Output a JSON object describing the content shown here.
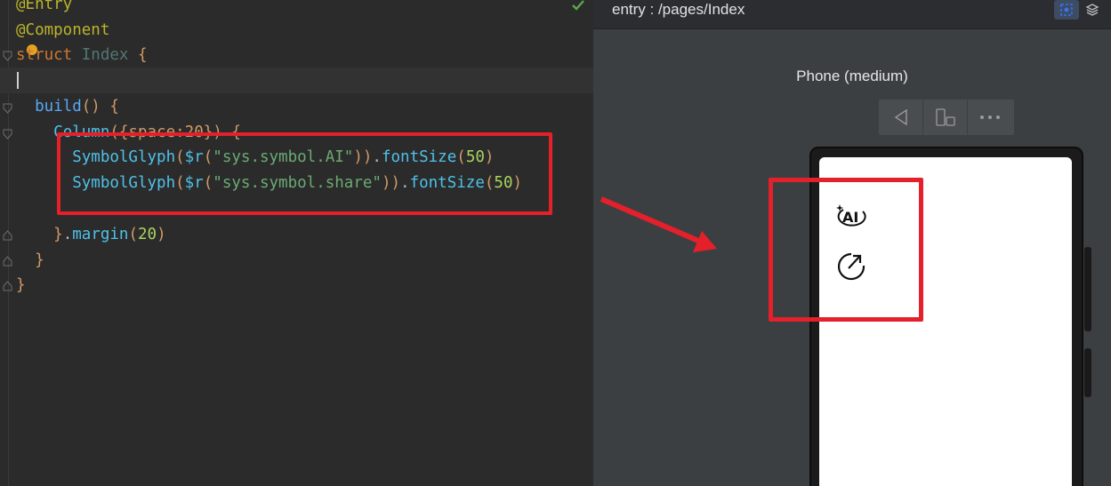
{
  "editor": {
    "lines": {
      "l0": {
        "annotation": "@Entry"
      },
      "l1": {
        "annotation": "@Component"
      },
      "l2": {
        "kw": "struct",
        "name": "Index",
        "brace": "{"
      },
      "l4": {
        "fn": "build",
        "parens": "()",
        "brace": "{"
      },
      "l5": {
        "fn": "Column",
        "args": "({space:20})",
        "brace": "{"
      },
      "l6": {
        "fn": "SymbolGlyph",
        "res": "$r",
        "open": "(",
        "str": "\"sys.symbol.AI\"",
        "close": "))",
        "dot": ".",
        "method": "fontSize",
        "popen": "(",
        "num": "50",
        "pclose": ")"
      },
      "l7": {
        "fn": "SymbolGlyph",
        "res": "$r",
        "open": "(",
        "str": "\"sys.symbol.share\"",
        "close": "))",
        "dot": ".",
        "method": "fontSize",
        "popen": "(",
        "num": "50",
        "pclose": ")"
      },
      "l9": {
        "close": "}",
        "dot": ".",
        "method": "margin",
        "popen": "(",
        "num": "20",
        "pclose": ")"
      },
      "l10": {
        "close": "}"
      },
      "l11": {
        "close": "}"
      }
    }
  },
  "previewer": {
    "route": "entry : /pages/Index",
    "device_name": "Phone (medium)",
    "toolbar": {
      "back_icon": "triangle-back-icon",
      "rotate_icon": "device-rotate-icon",
      "more_icon": "more-dots-icon"
    },
    "header_icons": [
      "inspector-icon",
      "layers-icon"
    ],
    "screen_glyphs": [
      "ai-symbol-icon",
      "share-symbol-icon"
    ],
    "screen_glyph_ai_text": "AI"
  },
  "colors": {
    "editor_bg": "#2b2b2b",
    "preview_bg": "#3c3f41",
    "highlight": "#e4202b",
    "accent_blue": "#3574f0"
  }
}
